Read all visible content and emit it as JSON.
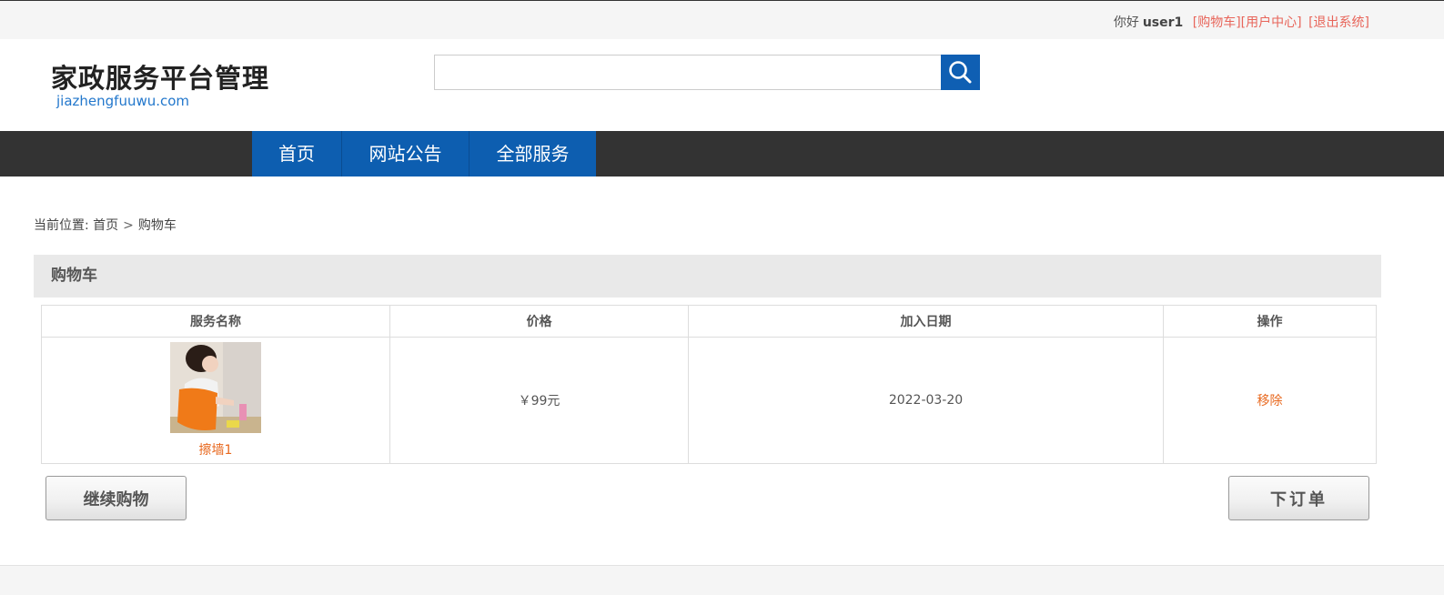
{
  "topbar": {
    "greeting": "你好",
    "username": "user1",
    "links": {
      "cart": "[购物车]",
      "user_center": "[用户中心]",
      "logout": "[退出系统]"
    }
  },
  "logo": {
    "cn": "家政服务平台管理",
    "en": "jiazhengfuuwu.com"
  },
  "search": {
    "value": "",
    "placeholder": "",
    "icon": "search-icon"
  },
  "nav": [
    {
      "label": "首页"
    },
    {
      "label": "网站公告"
    },
    {
      "label": "全部服务"
    }
  ],
  "breadcrumb": {
    "prefix": "当前位置:",
    "home": "首页",
    "separator": ">",
    "current": "购物车"
  },
  "panel_title": "购物车",
  "table": {
    "headers": [
      "服务名称",
      "价格",
      "加入日期",
      "操作"
    ],
    "rows": [
      {
        "name": "擦墙1",
        "price": "￥99元",
        "date": "2022-03-20",
        "action": "移除"
      }
    ]
  },
  "buttons": {
    "continue": "继续购物",
    "order": "下订单"
  },
  "colors": {
    "nav_bg": "#333333",
    "nav_active": "#0d5eb0",
    "link": "#e8655a",
    "accent": "#e8681e",
    "search_btn": "#0f5fb3"
  }
}
